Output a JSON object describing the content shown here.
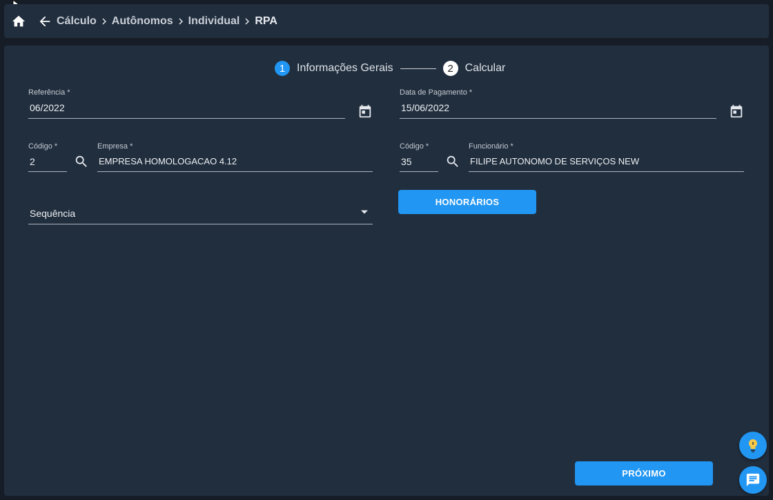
{
  "breadcrumb": {
    "items": [
      "Cálculo",
      "Autônomos",
      "Individual",
      "RPA"
    ]
  },
  "stepper": {
    "steps": [
      {
        "number": "1",
        "label": "Informações Gerais"
      },
      {
        "number": "2",
        "label": "Calcular"
      }
    ]
  },
  "form": {
    "referencia": {
      "label": "Referência *",
      "value": "06/2022"
    },
    "data_pagamento": {
      "label": "Data de Pagamento *",
      "value": "15/06/2022"
    },
    "empresa_codigo": {
      "label": "Código *",
      "value": "2"
    },
    "empresa": {
      "label": "Empresa *",
      "value": "EMPRESA HOMOLOGACAO 4.12"
    },
    "funcionario_codigo": {
      "label": "Código *",
      "value": "35"
    },
    "funcionario": {
      "label": "Funcionário *",
      "value": "FILIPE AUTONOMO DE SERVIÇOS NEW"
    },
    "sequencia": {
      "placeholder": "Sequência"
    }
  },
  "buttons": {
    "honorarios": "HONORÁRIOS",
    "proximo": "PRÓXIMO"
  },
  "colors": {
    "accent": "#2196f3",
    "panel": "#212e3e",
    "background": "#161d26"
  },
  "icons": [
    "home-icon",
    "arrow-back-icon",
    "chevron-right-icon",
    "calendar-icon",
    "search-icon",
    "dropdown-arrow-icon",
    "lightbulb-icon",
    "chat-icon"
  ]
}
